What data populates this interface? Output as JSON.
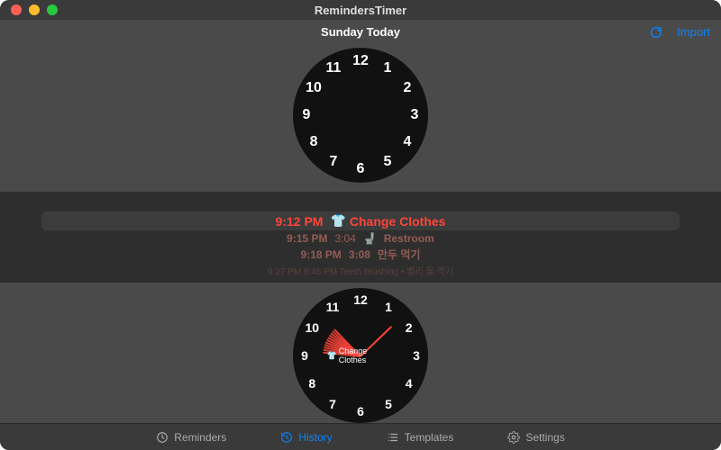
{
  "window": {
    "title": "RemindersTimer"
  },
  "header": {
    "day_label": "Sunday Today",
    "import_label": "Import"
  },
  "clock_top": {
    "numbers": [
      "12",
      "1",
      "2",
      "3",
      "4",
      "5",
      "6",
      "7",
      "8",
      "9",
      "10",
      "11"
    ]
  },
  "events": {
    "row1": {
      "time": "9:12 PM",
      "emoji": "👕",
      "label": "Change Clothes"
    },
    "row2": {
      "time": "9:15 PM",
      "dur": "3:04",
      "emoji": "🚽",
      "label": "Restroom"
    },
    "row3": {
      "time": "9:18 PM",
      "dur": "3:08",
      "label": "만두 먹기"
    },
    "row4": {
      "text": "9:27 PM 8:46 PM Teeth brushing • 빨리 물 먹기"
    }
  },
  "clock_bottom": {
    "numbers": [
      "12",
      "1",
      "2",
      "3",
      "4",
      "5",
      "6",
      "7",
      "8",
      "9",
      "10",
      "11"
    ],
    "center_emoji": "👕",
    "center_label": "Change Clothes",
    "hands_deg": [
      186,
      190,
      194,
      198,
      202,
      206,
      210,
      214,
      218,
      222,
      226,
      316
    ]
  },
  "nav": {
    "reminders": "Reminders",
    "history": "History",
    "templates": "Templates",
    "settings": "Settings",
    "active": "history"
  },
  "colors": {
    "accent": "#0a84ff",
    "danger": "#ff453a"
  }
}
